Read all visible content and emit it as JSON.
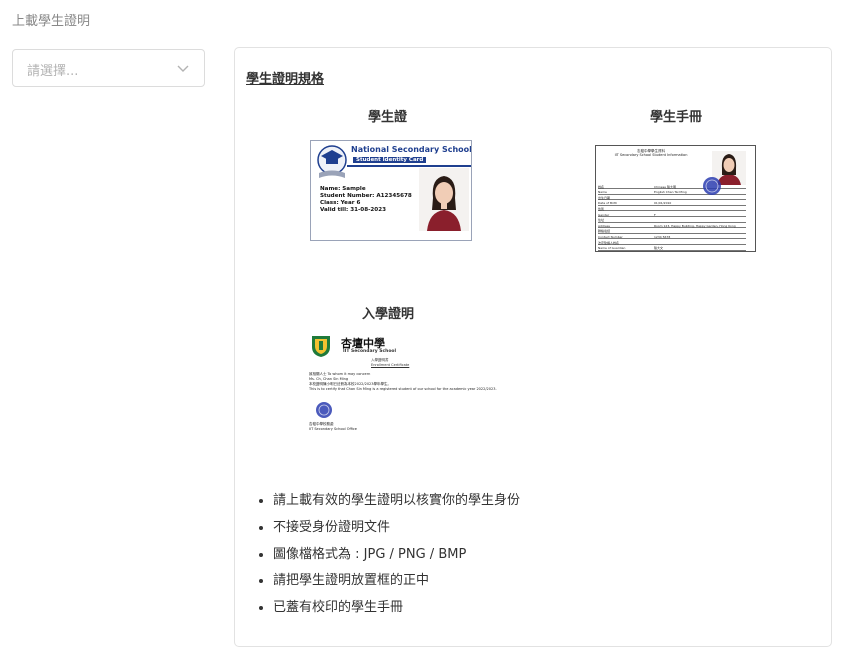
{
  "page_title": "上載學生證明",
  "select": {
    "placeholder": "請選擇..."
  },
  "spec": {
    "title": "學生證明規格",
    "student_card": {
      "label": "學生證",
      "school": "National Secondary School",
      "subtitle": "Student Identity Card",
      "name": "Name: Sample",
      "student_number": "Student Number: A12345678",
      "class": "Class: Year 6",
      "valid": "Valid till: 31-08-2023"
    },
    "handbook": {
      "label": "學生手冊",
      "header_cn": "志壇中學學生資料",
      "header_en": "IIT Secondary School Student Information",
      "rows": [
        {
          "l": "姓名",
          "m": "Chinese  陳大明"
        },
        {
          "l": "Name",
          "m": "English  Chan Tai Ming"
        },
        {
          "l": "出生日期",
          "m": ""
        },
        {
          "l": "Date of Birth",
          "m": "01/01/2010"
        },
        {
          "l": "性別",
          "m": ""
        },
        {
          "l": "Gender",
          "m": "F"
        },
        {
          "l": "住址",
          "m": ""
        },
        {
          "l": "Address",
          "m": "Room 123, Happy Building, Happy Garden, Hong Kong"
        },
        {
          "l": "聯絡電話",
          "m": ""
        },
        {
          "l": "Contact Number",
          "m": "1234 5678"
        },
        {
          "l": "法定監護人姓名",
          "m": ""
        },
        {
          "l": "Name of Guardian",
          "m": "陳大文"
        }
      ]
    },
    "admission": {
      "label": "入學證明",
      "school_cn": "杏壇中學",
      "school_en": "IIT Secondary School",
      "title_cn": "入學證明書",
      "title_en": "Enrollment Certificate",
      "lines": [
        "致相關人士 To whom it may concern",
        "Ms. Ch, Chan Sin Ming",
        "本校證明陳小明已註冊為本校2022/2023學年學生。",
        "This is to certify that Chan Sin Ming is a registered student of our school for the academic year 2022/2023."
      ],
      "office_cn": "杏壇中學校務處",
      "office_en": "IIT Secondary School Office"
    },
    "notes": [
      "請上載有效的學生證明以核實你的學生身份",
      "不接受身份證明文件",
      "圖像檔格式為 : JPG / PNG / BMP",
      "請把學生證明放置框的正中",
      "已蓋有校印的學生手冊"
    ]
  }
}
